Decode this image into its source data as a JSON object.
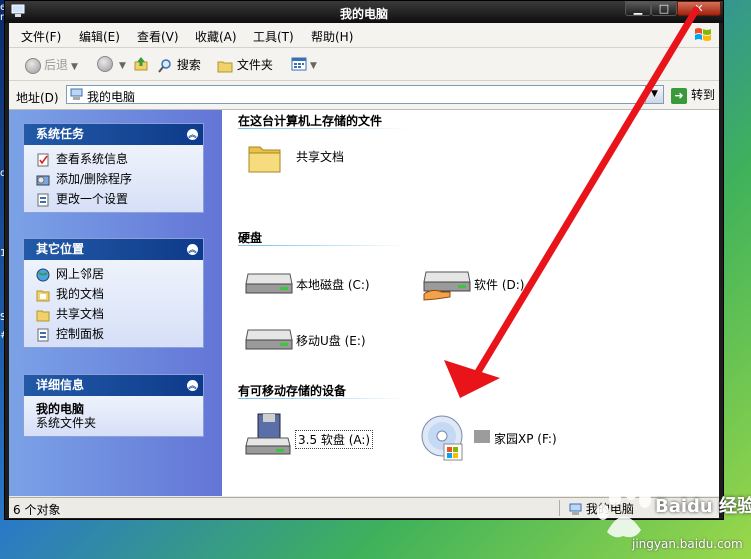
{
  "desktop_edge_chars": [
    "e",
    "r",
    "o",
    "1",
    "S",
    "#"
  ],
  "window": {
    "title": "我的电脑",
    "controls": {
      "min": "▁",
      "max": "□",
      "close": "✕"
    }
  },
  "menubar": {
    "items": [
      "文件(F)",
      "编辑(E)",
      "查看(V)",
      "收藏(A)",
      "工具(T)",
      "帮助(H)"
    ]
  },
  "toolbar": {
    "back_label": "后退",
    "search_label": "搜索",
    "folders_label": "文件夹"
  },
  "address": {
    "label": "地址(D)",
    "value": "我的电脑",
    "go_label": "转到"
  },
  "left_panels": {
    "system_tasks": {
      "title": "系统任务",
      "items": [
        {
          "label": "查看系统信息",
          "icon": "system-info-icon"
        },
        {
          "label": "添加/删除程序",
          "icon": "add-remove-programs-icon"
        },
        {
          "label": "更改一个设置",
          "icon": "control-panel-icon"
        }
      ]
    },
    "other_places": {
      "title": "其它位置",
      "items": [
        {
          "label": "网上邻居",
          "icon": "network-icon"
        },
        {
          "label": "我的文档",
          "icon": "documents-icon"
        },
        {
          "label": "共享文档",
          "icon": "folder-icon"
        },
        {
          "label": "控制面板",
          "icon": "control-panel-icon"
        }
      ]
    },
    "details": {
      "title": "详细信息",
      "name": "我的电脑",
      "type": "系统文件夹"
    }
  },
  "groups": {
    "stored_files": {
      "title": "在这台计算机上存储的文件",
      "items": [
        {
          "label": "共享文档",
          "icon": "folder-icon"
        }
      ]
    },
    "hard_disks": {
      "title": "硬盘",
      "items": [
        {
          "label": "本地磁盘 (C:)",
          "icon": "hard-drive-icon"
        },
        {
          "label": "软件 (D:)",
          "icon": "shared-drive-icon"
        },
        {
          "label": "移动U盘 (E:)",
          "icon": "hard-drive-icon"
        }
      ]
    },
    "removable": {
      "title": "有可移动存储的设备",
      "items": [
        {
          "label": "3.5 软盘 (A:)",
          "icon": "floppy-drive-icon"
        },
        {
          "label": "家园XP (F:)",
          "icon": "cd-drive-icon"
        }
      ]
    }
  },
  "status": {
    "count": "6 个对象",
    "location": "我的电脑"
  },
  "watermark": {
    "text": "Baidu 经验",
    "url": "jingyan.baidu.com"
  },
  "colors": {
    "annotation_arrow": "#e8141a",
    "panel_header": "#225aa7",
    "title_bar": "#1d1d1d"
  }
}
